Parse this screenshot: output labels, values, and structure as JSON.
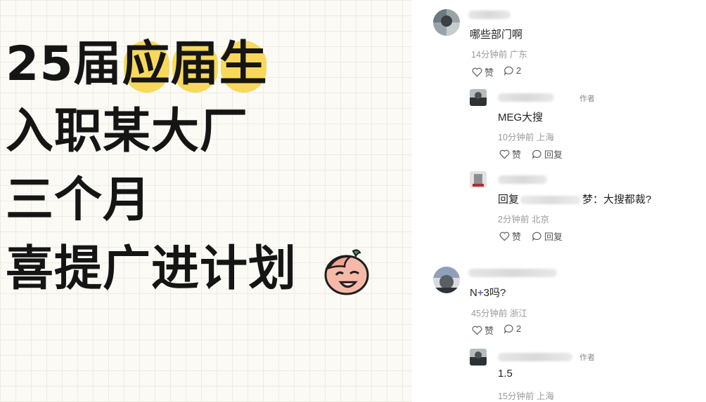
{
  "poster": {
    "line1_prefix": "25届",
    "line1_highlight_1": "应",
    "line1_highlight_2": "届",
    "line1_highlight_3": "生",
    "line2": "入职某大厂",
    "line3": "三个月",
    "line4": "喜提广进计划",
    "highlight_color": "#f7d85c",
    "emoji_icon": "facepalm-crying-face-icon"
  },
  "comments": [
    {
      "text": "哪些部门啊",
      "time": "14分钟前",
      "location": "广东",
      "like_label": "赞",
      "reply_count": "2",
      "replies": [
        {
          "author_tag": "作者",
          "text": "MEG大搜",
          "time": "10分钟前",
          "location": "上海",
          "like_label": "赞",
          "reply_label": "回复"
        },
        {
          "prefix": "回复",
          "mention_suffix": "梦",
          "text": "：大搜都裁?",
          "time": "2分钟前",
          "location": "北京",
          "like_label": "赞",
          "reply_label": "回复"
        }
      ]
    },
    {
      "text_a": "N",
      "text_plus": "+",
      "text_b": "3吗?",
      "time": "45分钟前",
      "location": "浙江",
      "like_label": "赞",
      "reply_count": "2",
      "replies": [
        {
          "author_tag": "作者",
          "text": "1.5",
          "time": "15分钟前",
          "location": "上海"
        }
      ]
    }
  ]
}
